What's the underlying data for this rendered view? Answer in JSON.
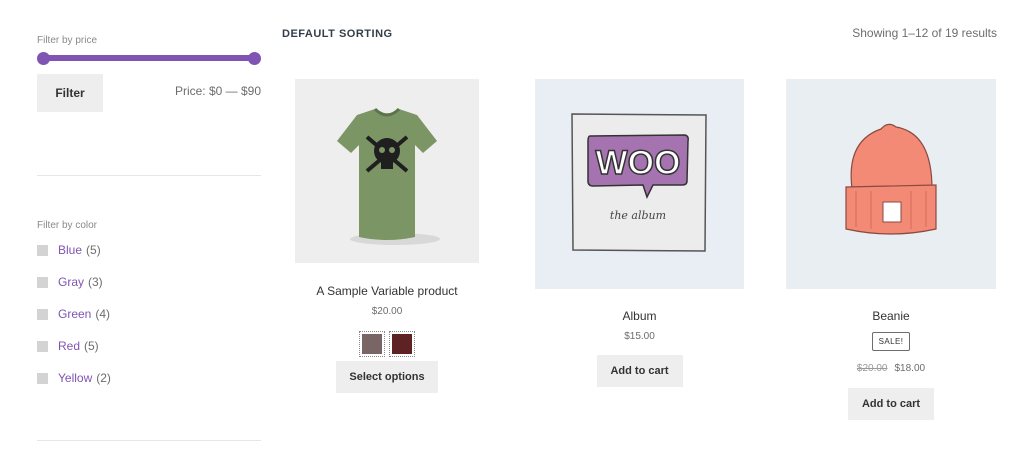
{
  "sidebar": {
    "price_filter": {
      "title": "Filter by price",
      "button_label": "Filter",
      "price_label": "Price: $0 — $90",
      "range_min_fraction": 0.0,
      "range_max_fraction": 1.0
    },
    "color_filter": {
      "title": "Filter by color",
      "items": [
        {
          "name": "Blue",
          "count": "(5)"
        },
        {
          "name": "Gray",
          "count": "(3)"
        },
        {
          "name": "Green",
          "count": "(4)"
        },
        {
          "name": "Red",
          "count": "(5)"
        },
        {
          "name": "Yellow",
          "count": "(2)"
        }
      ]
    }
  },
  "toolbar": {
    "sorting_label": "DEFAULT SORTING",
    "result_count": "Showing 1–12 of 19 results"
  },
  "products": [
    {
      "title": "A Sample Variable product",
      "price": "$20.00",
      "button_label": "Select options",
      "image_icon": "tshirt-image",
      "swatches": [
        "#7a6566",
        "#5e2225"
      ]
    },
    {
      "title": "Album",
      "price": "$15.00",
      "button_label": "Add to cart",
      "image_icon": "album-image",
      "image_text": "WOO",
      "image_subtext": "the album"
    },
    {
      "title": "Beanie",
      "badge": "SALE!",
      "old_price": "$20.00",
      "price": "$18.00",
      "button_label": "Add to cart",
      "image_icon": "beanie-image"
    }
  ],
  "colors": {
    "accent": "#7f54b3",
    "button_bg": "#eeeeee",
    "divider": "#e6e6e6"
  }
}
